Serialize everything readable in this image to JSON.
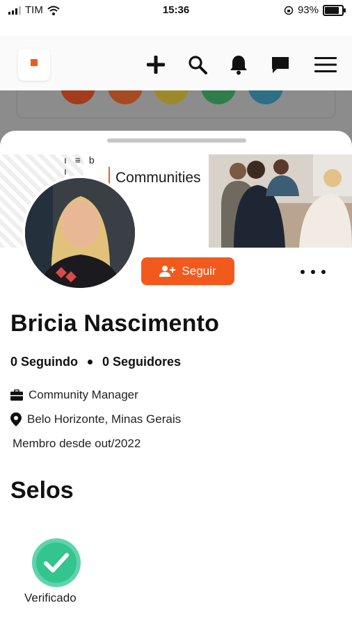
{
  "status_bar": {
    "carrier": "TIM",
    "time": "15:36",
    "battery": "93%",
    "battery_level": 0.93
  },
  "header": {
    "icons": [
      "add-icon",
      "search-icon",
      "bell-icon",
      "chat-icon",
      "menu-icon"
    ]
  },
  "cover": {
    "brand_text": "Communities"
  },
  "profile": {
    "follow_label": "Seguir",
    "name": "Bricia Nascimento",
    "following": "0 Seguindo",
    "followers": "0 Seguidores",
    "role": "Community Manager",
    "location": "Belo Horizonte, Minas Gerais",
    "member_since": "Membro desde out/2022"
  },
  "badges": {
    "title": "Selos",
    "items": [
      {
        "label": "Verificado"
      }
    ]
  },
  "colors": {
    "accent": "#f25a1d",
    "badge_green": "#34c48e"
  }
}
